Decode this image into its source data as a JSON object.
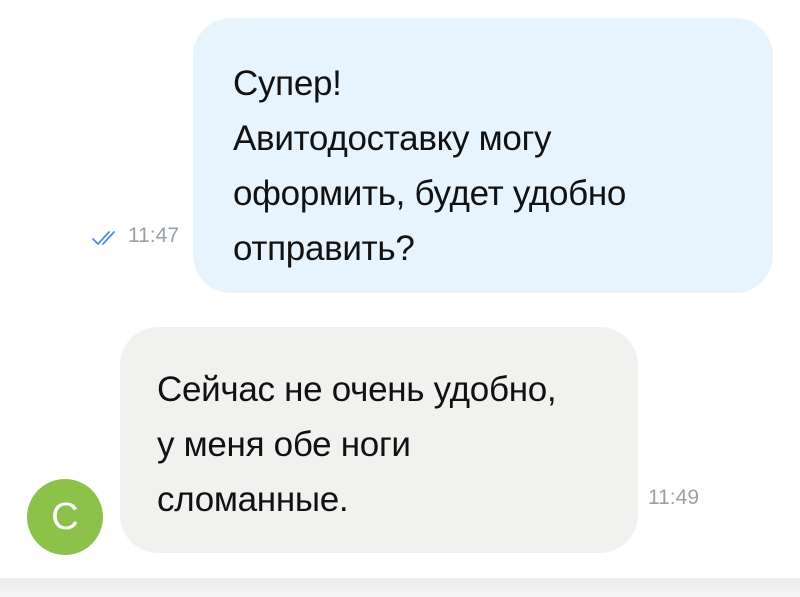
{
  "outgoing_message": {
    "text": "Супер!\nАвитодоставку могу\nоформить, будет удобно\nотправить?",
    "time": "11:47",
    "status_icon": "double-check-icon",
    "bubble_color": "#e7f3fd"
  },
  "incoming_message": {
    "text": "Сейчас не очень удобно,\nу меня обе ноги\nсломанные.",
    "time": "11:49",
    "bubble_color": "#f1f1f0"
  },
  "sender_avatar": {
    "initial": "С",
    "color": "#8cc24a"
  },
  "colors": {
    "read_status": "#4a90e2",
    "timestamp": "#9aa0a6"
  }
}
